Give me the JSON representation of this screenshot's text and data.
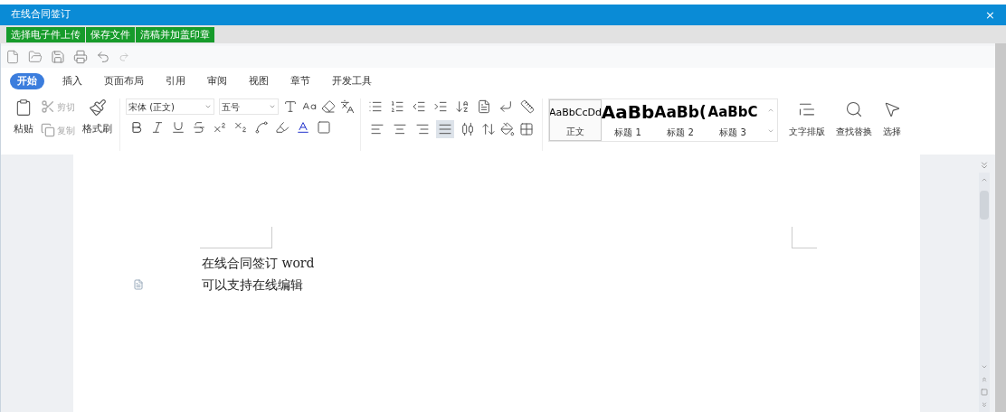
{
  "window": {
    "title": "在线合同签订",
    "close": "×"
  },
  "action_buttons": [
    "选择电子件上传",
    "保存文件",
    "清稿并加盖印章"
  ],
  "ribbon_tabs": [
    {
      "label": "开始",
      "selected": true
    },
    {
      "label": "插入",
      "selected": false
    },
    {
      "label": "页面布局",
      "selected": false
    },
    {
      "label": "引用",
      "selected": false
    },
    {
      "label": "审阅",
      "selected": false
    },
    {
      "label": "视图",
      "selected": false
    },
    {
      "label": "章节",
      "selected": false
    },
    {
      "label": "开发工具",
      "selected": false
    }
  ],
  "clipboard": {
    "paste": "粘贴",
    "cut": "剪切",
    "copy": "复制",
    "format_painter": "格式刷"
  },
  "font": {
    "name": "宋体 (正文)",
    "size": "五号"
  },
  "paragraph_align": [
    {
      "kind": "left",
      "selected": false
    },
    {
      "kind": "center",
      "selected": false
    },
    {
      "kind": "right",
      "selected": false
    },
    {
      "kind": "justify",
      "selected": true
    },
    {
      "kind": "distributed",
      "selected": false
    }
  ],
  "styles": [
    {
      "sample": "AaBbCcDd",
      "label": "正文",
      "kind": "body",
      "selected": true
    },
    {
      "sample": "AaBb",
      "label": "标题 1",
      "kind": "h1",
      "selected": false
    },
    {
      "sample": "AaBb(",
      "label": "标题 2",
      "kind": "h2",
      "selected": false
    },
    {
      "sample": "AaBbC",
      "label": "标题 3",
      "kind": "h3",
      "selected": false
    }
  ],
  "tools": [
    {
      "kind": "layout",
      "label": "文字排版"
    },
    {
      "kind": "find",
      "label": "查找替换"
    },
    {
      "kind": "select",
      "label": "选择"
    }
  ],
  "document": {
    "lines": [
      "在线合同签订 word",
      "可以支持在线编辑"
    ]
  }
}
